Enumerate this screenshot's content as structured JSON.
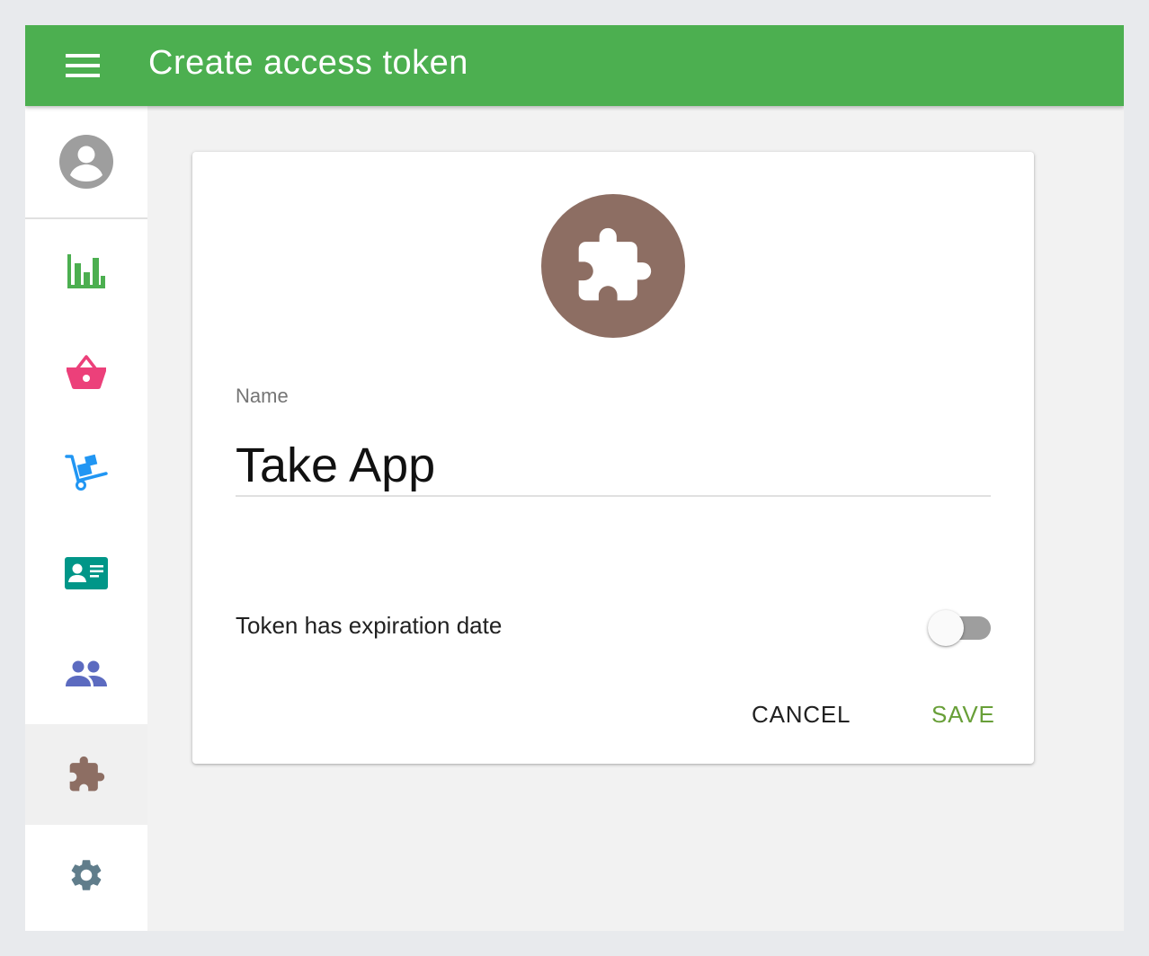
{
  "header": {
    "menu_icon": "menu-icon",
    "title": "Create access token"
  },
  "sidebar": {
    "avatar_icon": "account-circle-icon",
    "items": [
      {
        "id": "statistics",
        "icon": "bar-chart-icon",
        "color": "#4caf50"
      },
      {
        "id": "orders",
        "icon": "basket-icon",
        "color": "#ec407a"
      },
      {
        "id": "delivery",
        "icon": "hand-truck-icon",
        "color": "#2196f3"
      },
      {
        "id": "contacts",
        "icon": "contact-card-icon",
        "color": "#009688"
      },
      {
        "id": "team",
        "icon": "people-icon",
        "color": "#5c6bc0"
      },
      {
        "id": "apps",
        "icon": "puzzle-icon",
        "color": "#8d6e63",
        "active": true
      },
      {
        "id": "settings",
        "icon": "gear-icon",
        "color": "#607d8b"
      }
    ]
  },
  "form": {
    "app_icon": "puzzle-icon",
    "icon_color": "#8d6e63",
    "name_label": "Name",
    "name_value": "Take App",
    "expiration_label": "Token has expiration date",
    "expiration_enabled": false,
    "cancel_label": "CANCEL",
    "save_label": "SAVE"
  },
  "colors": {
    "app_bar": "#4caf50",
    "save_accent": "#689f38"
  }
}
